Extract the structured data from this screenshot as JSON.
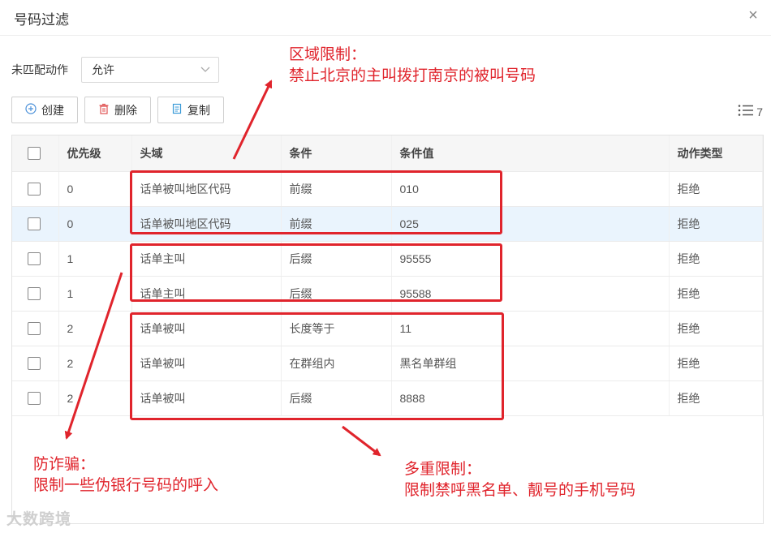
{
  "dialog": {
    "title": "号码过滤",
    "close": "×"
  },
  "filter": {
    "label": "未匹配动作",
    "value": "允许"
  },
  "toolbar": {
    "create": "创建",
    "delete": "删除",
    "copy": "复制",
    "column_count": "7"
  },
  "table": {
    "headers": [
      "优先级",
      "头域",
      "条件",
      "条件值",
      "动作类型"
    ],
    "rows": [
      {
        "priority": "0",
        "field": "话单被叫地区代码",
        "condition": "前缀",
        "value": "010",
        "action": "拒绝"
      },
      {
        "priority": "0",
        "field": "话单被叫地区代码",
        "condition": "前缀",
        "value": "025",
        "action": "拒绝"
      },
      {
        "priority": "1",
        "field": "话单主叫",
        "condition": "后缀",
        "value": "95555",
        "action": "拒绝"
      },
      {
        "priority": "1",
        "field": "话单主叫",
        "condition": "后缀",
        "value": "95588",
        "action": "拒绝"
      },
      {
        "priority": "2",
        "field": "话单被叫",
        "condition": "长度等于",
        "value": "11",
        "action": "拒绝"
      },
      {
        "priority": "2",
        "field": "话单被叫",
        "condition": "在群组内",
        "value": "黑名单群组",
        "action": "拒绝"
      },
      {
        "priority": "2",
        "field": "话单被叫",
        "condition": "后缀",
        "value": "8888",
        "action": "拒绝"
      }
    ]
  },
  "annotations": {
    "region_title": "区域限制：",
    "region_desc": "禁止北京的主叫拨打南京的被叫号码",
    "fraud_title": "防诈骗：",
    "fraud_desc": "限制一些伪银行号码的呼入",
    "multi_title": "多重限制：",
    "multi_desc": "限制禁呼黑名单、靓号的手机号码",
    "color": "#e0242c"
  },
  "watermark": "大数跨境",
  "highlight_row": 1
}
